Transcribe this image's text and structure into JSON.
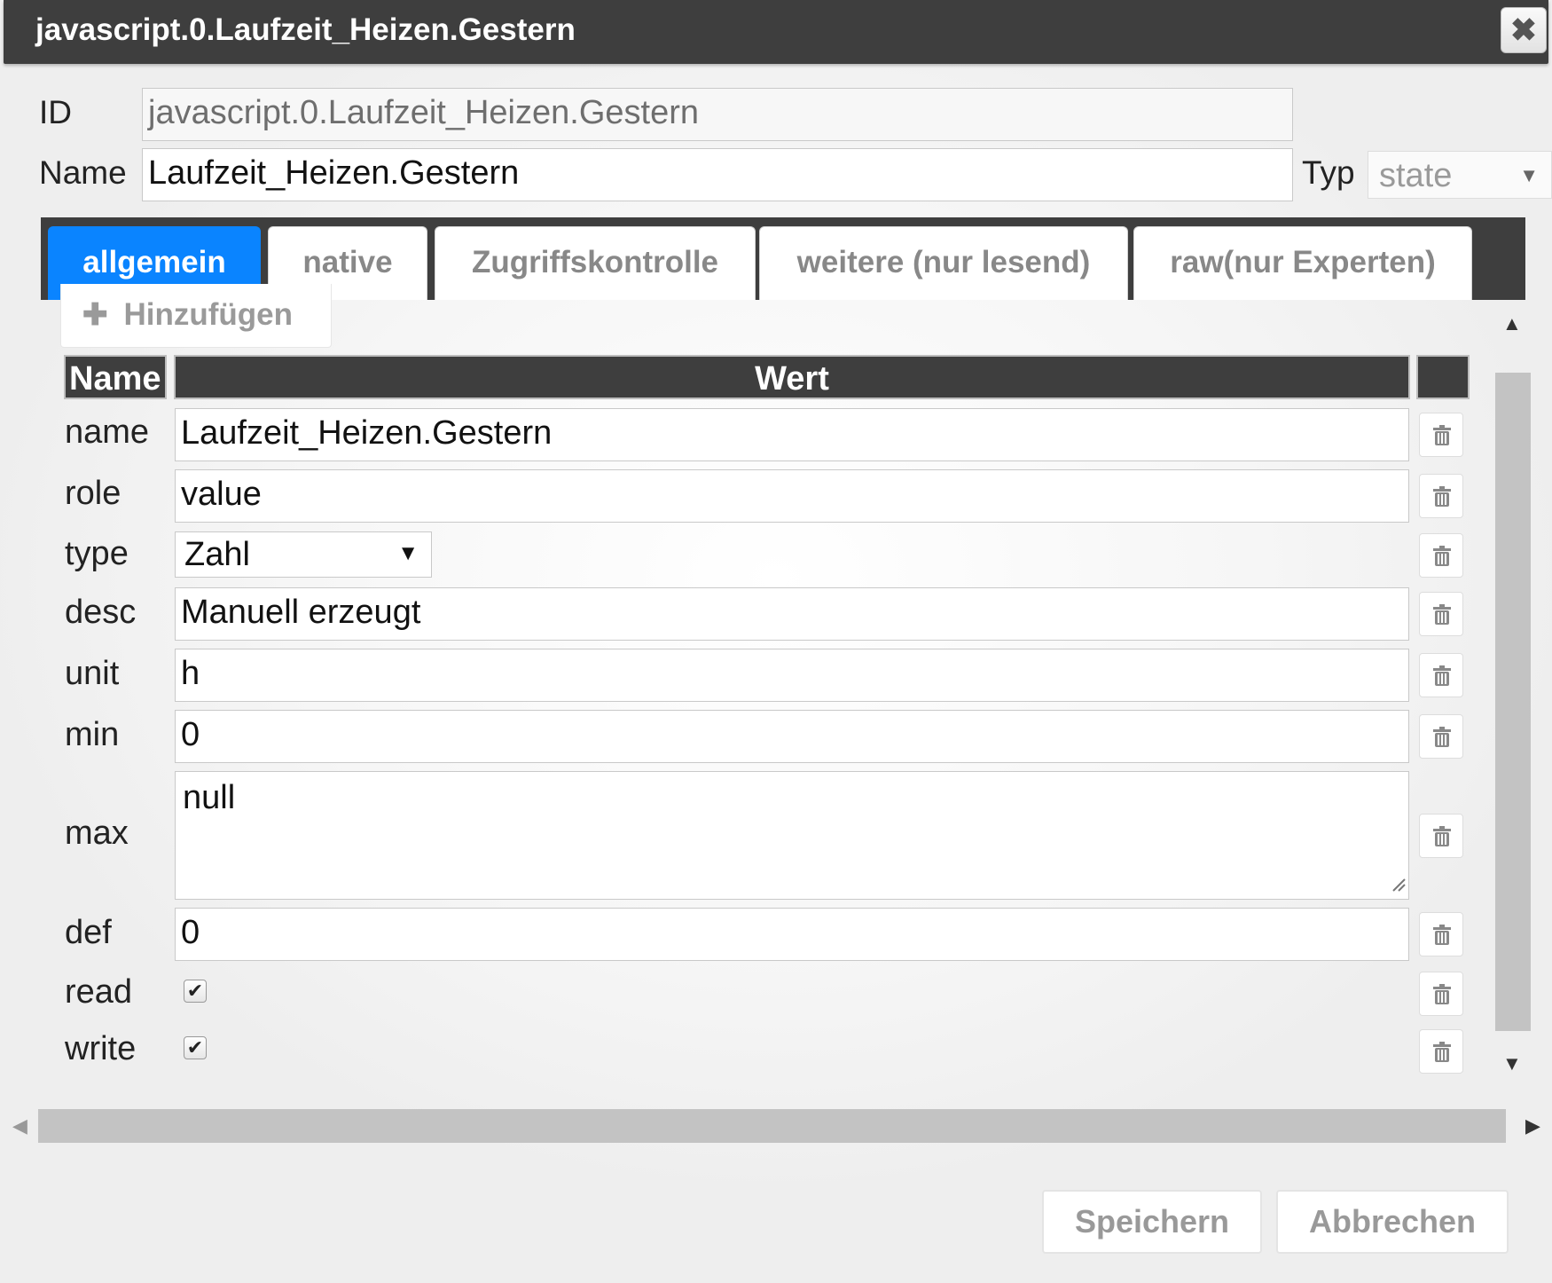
{
  "dialog": {
    "title": "javascript.0.Laufzeit_Heizen.Gestern",
    "close_label": "✖"
  },
  "header": {
    "id_label": "ID",
    "id_value": "javascript.0.Laufzeit_Heizen.Gestern",
    "name_label": "Name",
    "name_value": "Laufzeit_Heizen.Gestern",
    "typ_label": "Typ",
    "typ_value": "state"
  },
  "tabs": [
    {
      "label": "allgemein",
      "active": true
    },
    {
      "label": "native",
      "active": false
    },
    {
      "label": "Zugriffskontrolle",
      "active": false
    },
    {
      "label": "weitere (nur lesend)",
      "active": false
    },
    {
      "label": "raw(nur Experten)",
      "active": false
    }
  ],
  "add_button": {
    "icon": "plus-icon",
    "label": "Hinzufügen"
  },
  "table": {
    "headers": {
      "name": "Name",
      "value": "Wert",
      "actions": ""
    },
    "rows": [
      {
        "name": "name",
        "value": "Laufzeit_Heizen.Gestern",
        "kind": "text"
      },
      {
        "name": "role",
        "value": "value",
        "kind": "text"
      },
      {
        "name": "type",
        "value": "Zahl",
        "kind": "select"
      },
      {
        "name": "desc",
        "value": "Manuell erzeugt",
        "kind": "text"
      },
      {
        "name": "unit",
        "value": "h",
        "kind": "text"
      },
      {
        "name": "min",
        "value": "0",
        "kind": "text"
      },
      {
        "name": "max",
        "value": "null",
        "kind": "textarea"
      },
      {
        "name": "def",
        "value": "0",
        "kind": "text"
      },
      {
        "name": "read",
        "value": true,
        "kind": "checkbox"
      },
      {
        "name": "write",
        "value": true,
        "kind": "checkbox"
      }
    ],
    "delete_icon": "trash-icon"
  },
  "footer": {
    "save_label": "Speichern",
    "cancel_label": "Abbrechen"
  },
  "colors": {
    "titlebar": "#3e3e3e",
    "active_tab": "#0a84ff",
    "scrollbar": "#c3c3c3"
  }
}
